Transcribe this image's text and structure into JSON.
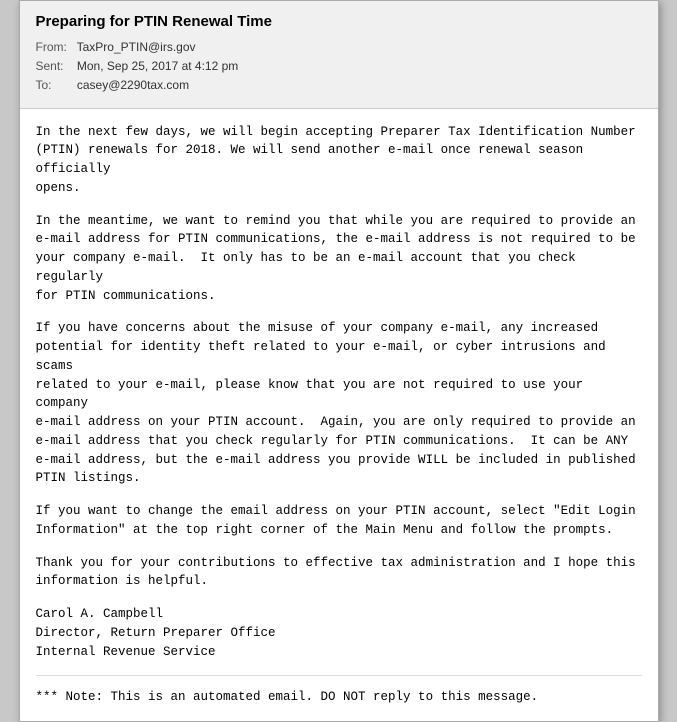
{
  "email": {
    "subject": "Preparing for PTIN Renewal Time",
    "from_label": "From:",
    "from_value": "TaxPro_PTIN@irs.gov",
    "sent_label": "Sent:",
    "sent_value": "Mon, Sep 25, 2017 at 4:12 pm",
    "to_label": "To:",
    "to_value": "casey@2290tax.com",
    "body": {
      "paragraph1": "In the next few days, we will begin accepting Preparer Tax Identification Number\n(PTIN) renewals for 2018. We will send another e-mail once renewal season officially\nopens.",
      "paragraph2": "In the meantime, we want to remind you that while you are required to provide an\ne-mail address for PTIN communications, the e-mail address is not required to be\nyour company e-mail.  It only has to be an e-mail account that you check regularly\nfor PTIN communications.",
      "paragraph3": "If you have concerns about the misuse of your company e-mail, any increased\npotential for identity theft related to your e-mail, or cyber intrusions and scams\nrelated to your e-mail, please know that you are not required to use your company\ne-mail address on your PTIN account.  Again, you are only required to provide an\ne-mail address that you check regularly for PTIN communications.  It can be ANY\ne-mail address, but the e-mail address you provide WILL be included in published\nPTIN listings.",
      "paragraph4": "If you want to change the email address on your PTIN account, select \"Edit Login\nInformation\" at the top right corner of the Main Menu and follow the prompts.",
      "paragraph5": "Thank you for your contributions to effective tax administration and I hope this\ninformation is helpful.",
      "signature_line1": "Carol A. Campbell",
      "signature_line2": "Director, Return Preparer Office",
      "signature_line3": "Internal Revenue Service",
      "note": "*** Note: This is an automated email. DO NOT reply to this message."
    }
  }
}
